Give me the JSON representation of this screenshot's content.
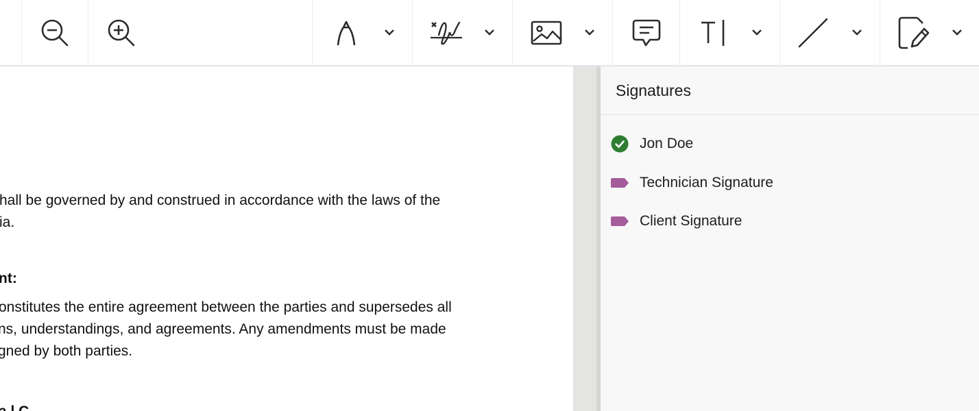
{
  "toolbar": {
    "icons": {
      "pan": "pan-icon",
      "zoom_out": "zoom-out-icon",
      "zoom_in": "zoom-in-icon",
      "ink": "ink-pen-icon",
      "signature": "signature-icon",
      "image": "image-icon",
      "comment": "comment-icon",
      "text": "text-icon",
      "line": "line-icon",
      "edit": "edit-document-icon",
      "chevron": "chevron-down-icon"
    }
  },
  "document": {
    "lines": [
      "hall be governed by and construed in accordance with the laws of the",
      "ia.",
      "nt:",
      "onstitutes the entire agreement between the parties and supersedes all",
      "ns, understandings, and agreements. Any amendments must be made",
      "gned by both parties.",
      "a l C"
    ]
  },
  "panel": {
    "title": "Signatures",
    "items": [
      {
        "label": "Jon Doe",
        "status": "signed",
        "icon": "check-circle-icon",
        "color": "#2e7d32"
      },
      {
        "label": "Technician Signature",
        "status": "pending",
        "icon": "tag-icon",
        "color": "#a45c9b"
      },
      {
        "label": "Client Signature",
        "status": "pending",
        "icon": "tag-icon",
        "color": "#a45c9b"
      }
    ]
  },
  "colors": {
    "signed": "#2e7d32",
    "field_tag": "#a45c9b",
    "icon_stroke": "#2b2b2e"
  }
}
